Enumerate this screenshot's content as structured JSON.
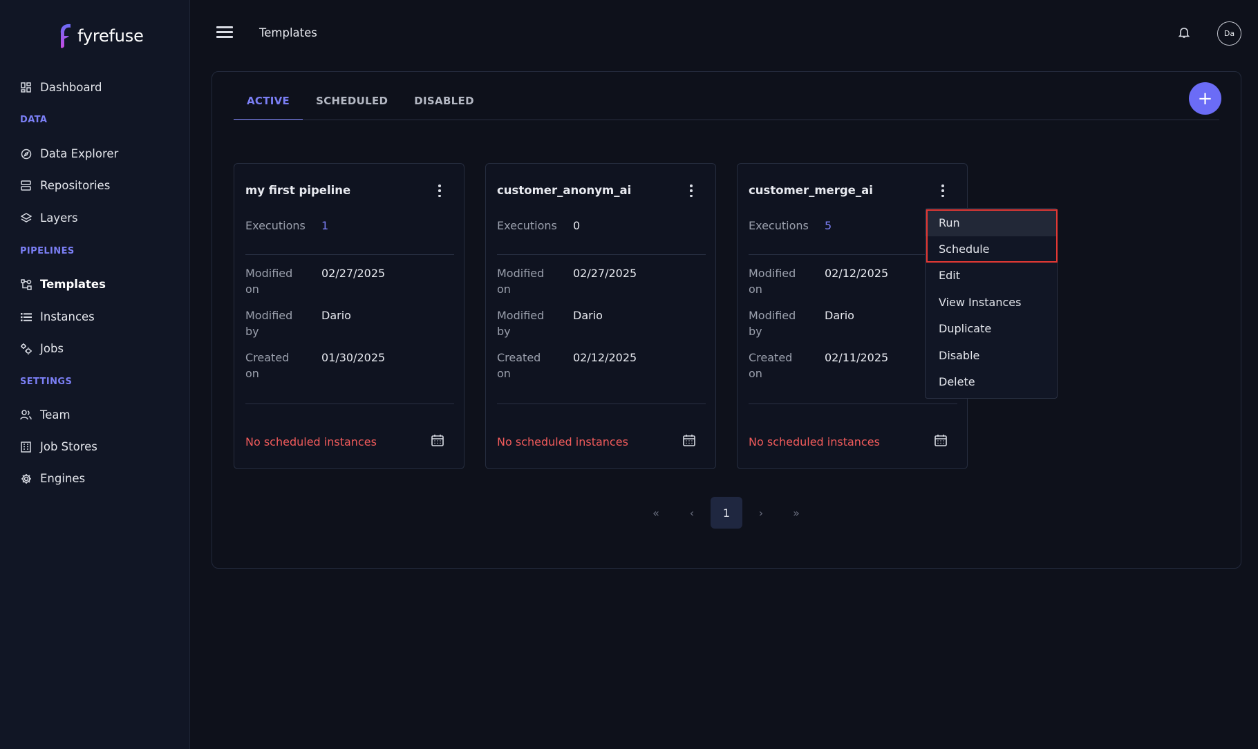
{
  "app": {
    "name": "fyrefuse"
  },
  "header": {
    "title": "Templates",
    "avatar_initials": "Da"
  },
  "sidebar": {
    "top_item": {
      "label": "Dashboard",
      "icon": "dashboard-icon"
    },
    "sections": [
      {
        "label": "DATA",
        "items": [
          {
            "label": "Data Explorer",
            "icon": "compass-icon"
          },
          {
            "label": "Repositories",
            "icon": "server-icon"
          },
          {
            "label": "Layers",
            "icon": "layers-icon"
          }
        ]
      },
      {
        "label": "PIPELINES",
        "items": [
          {
            "label": "Templates",
            "icon": "pipeline-icon",
            "active": true
          },
          {
            "label": "Instances",
            "icon": "list-icon"
          },
          {
            "label": "Jobs",
            "icon": "cogs-icon"
          }
        ]
      },
      {
        "label": "SETTINGS",
        "items": [
          {
            "label": "Team",
            "icon": "team-icon"
          },
          {
            "label": "Job Stores",
            "icon": "building-icon"
          },
          {
            "label": "Engines",
            "icon": "gear-icon"
          }
        ]
      }
    ]
  },
  "tabs": [
    {
      "label": "ACTIVE",
      "active": true
    },
    {
      "label": "SCHEDULED"
    },
    {
      "label": "DISABLED"
    }
  ],
  "add_button_label": "+",
  "cards": [
    {
      "title": "my first pipeline",
      "executions_label": "Executions",
      "executions": "1",
      "modified_on_label": "Modified on",
      "modified_on": "02/27/2025",
      "modified_by_label": "Modified by",
      "modified_by": "Dario",
      "created_on_label": "Created on",
      "created_on": "01/30/2025",
      "schedule_status": "No scheduled instances"
    },
    {
      "title": "customer_anonym_ai",
      "executions_label": "Executions",
      "executions": "0",
      "modified_on_label": "Modified on",
      "modified_on": "02/27/2025",
      "modified_by_label": "Modified by",
      "modified_by": "Dario",
      "created_on_label": "Created on",
      "created_on": "02/12/2025",
      "schedule_status": "No scheduled instances"
    },
    {
      "title": "customer_merge_ai",
      "executions_label": "Executions",
      "executions": "5",
      "modified_on_label": "Modified on",
      "modified_on": "02/12/2025",
      "modified_by_label": "Modified by",
      "modified_by": "Dario",
      "created_on_label": "Created on",
      "created_on": "02/11/2025",
      "schedule_status": "No scheduled instances"
    }
  ],
  "context_menu": {
    "items": [
      "Run",
      "Schedule",
      "Edit",
      "View Instances",
      "Duplicate",
      "Disable",
      "Delete"
    ]
  },
  "pagination": {
    "first": "«",
    "prev": "‹",
    "current": "1",
    "next": "›",
    "last": "»"
  },
  "colors": {
    "accent": "#7b7ff5",
    "danger": "#f15b5b",
    "background": "#0e111b",
    "sidebar": "#111625"
  }
}
